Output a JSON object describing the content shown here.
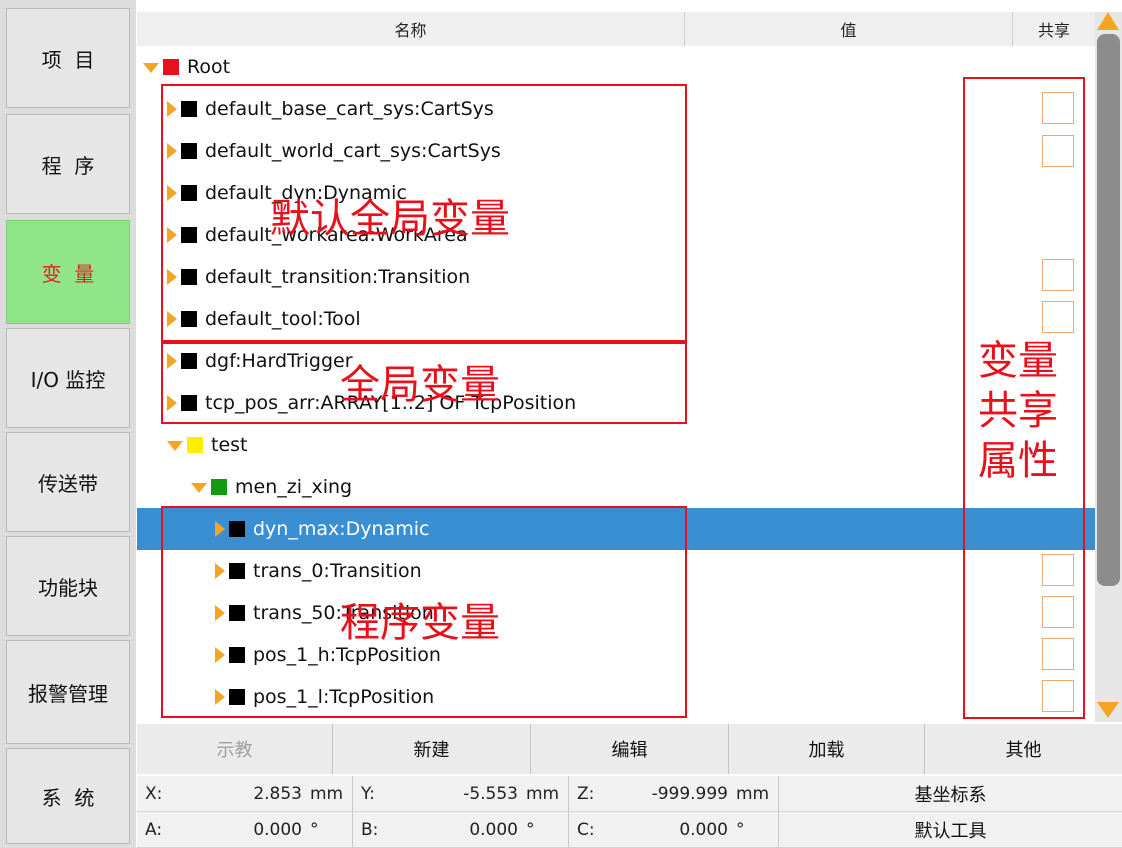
{
  "sidebar": {
    "items": [
      {
        "label": "项  目"
      },
      {
        "label": "程  序"
      },
      {
        "label": "变  量",
        "active": true
      },
      {
        "label": "I/O 监控"
      },
      {
        "label": "传送带"
      },
      {
        "label": "功能块"
      },
      {
        "label": "报警管理"
      },
      {
        "label": "系  统"
      }
    ]
  },
  "table": {
    "columns": [
      "名称",
      "值",
      "共享"
    ]
  },
  "tree": {
    "rows": [
      {
        "label": "Root",
        "expanded": true,
        "color": "#e8101a"
      },
      {
        "label": "default_base_cart_sys:CartSys",
        "color": "#000000"
      },
      {
        "label": "default_world_cart_sys:CartSys",
        "color": "#000000"
      },
      {
        "label": "default_dyn:Dynamic",
        "color": "#000000"
      },
      {
        "label": "default_workarea:WorkArea",
        "color": "#000000"
      },
      {
        "label": "default_transition:Transition",
        "color": "#000000"
      },
      {
        "label": "default_tool:Tool",
        "color": "#000000"
      },
      {
        "label": "dgf:HardTrigger",
        "color": "#000000"
      },
      {
        "label": "tcp_pos_arr:ARRAY[1..2] OF TcpPosition",
        "color": "#000000"
      },
      {
        "label": "test",
        "expanded": true,
        "color": "#ffee00"
      },
      {
        "label": "men_zi_xing",
        "expanded": true,
        "color": "#129a12"
      },
      {
        "label": "dyn_max:Dynamic",
        "color": "#000000",
        "selected": true
      },
      {
        "label": "trans_0:Transition",
        "color": "#000000"
      },
      {
        "label": "trans_50:Transition",
        "color": "#000000"
      },
      {
        "label": "pos_1_h:TcpPosition",
        "color": "#000000"
      },
      {
        "label": "pos_1_l:TcpPosition",
        "color": "#000000"
      }
    ]
  },
  "annotations": {
    "default_global": "默认全局变量",
    "global": "全局变量",
    "program": "程序变量",
    "share_line1": "变量",
    "share_line2": "共享",
    "share_line3": "属性"
  },
  "toolbar": {
    "teach": "示教",
    "new": "新建",
    "edit": "编辑",
    "load": "加载",
    "other": "其他"
  },
  "status": {
    "x_label": "X:",
    "x_value": "2.853",
    "x_unit": "mm",
    "y_label": "Y:",
    "y_value": "-5.553",
    "y_unit": "mm",
    "z_label": "Z:",
    "z_value": "-999.999",
    "z_unit": "mm",
    "a_label": "A:",
    "a_value": "0.000",
    "a_unit": "°",
    "b_label": "B:",
    "b_value": "0.000",
    "b_unit": "°",
    "c_label": "C:",
    "c_value": "0.000",
    "c_unit": "°",
    "coord_sys": "基坐标系",
    "tool": "默认工具"
  },
  "colors": {
    "accent": "#f4a623",
    "selection": "#3a8fd2",
    "active_nav": "#90e48a",
    "annotation": "#e8101a"
  }
}
